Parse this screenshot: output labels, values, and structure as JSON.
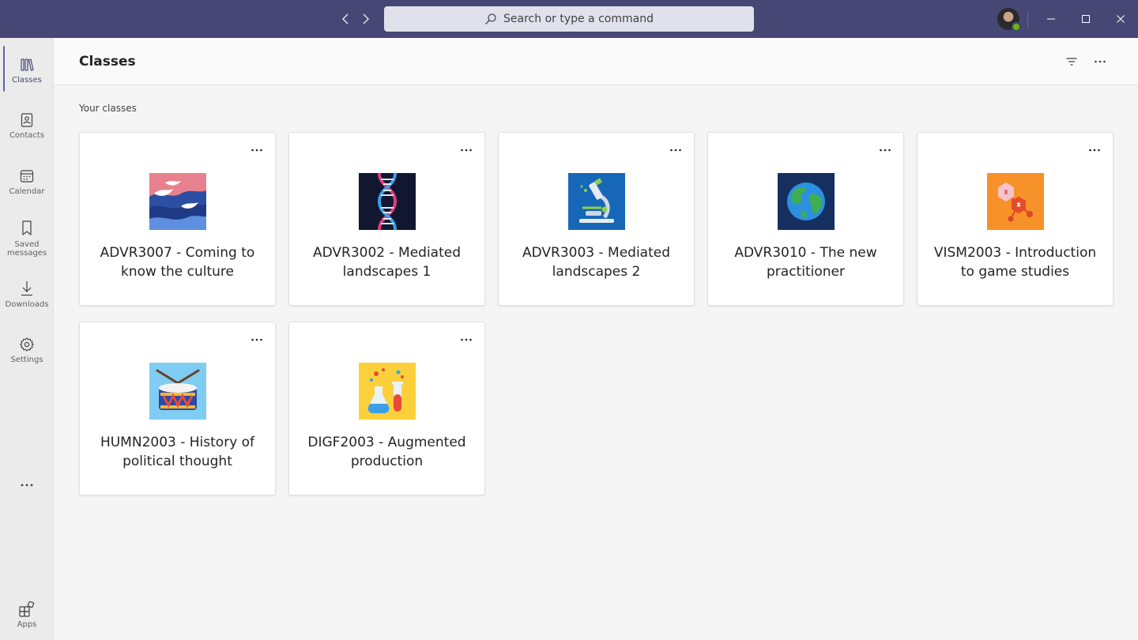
{
  "titlebar": {
    "search_placeholder": "Search or type a command"
  },
  "rail": {
    "items": [
      {
        "label": "Classes",
        "icon": "books-icon",
        "active": true
      },
      {
        "label": "Contacts",
        "icon": "contact-card-icon"
      },
      {
        "label": "Calendar",
        "icon": "calendar-icon"
      },
      {
        "label": "Saved messages",
        "icon": "bookmark-icon"
      },
      {
        "label": "Downloads",
        "icon": "download-icon"
      },
      {
        "label": "Settings",
        "icon": "gear-icon"
      },
      {
        "label": "Apps",
        "icon": "apps-icon"
      }
    ]
  },
  "header": {
    "title": "Classes"
  },
  "main": {
    "section_label": "Your classes",
    "classes": [
      {
        "title": "ADVR3007 - Coming to know the culture",
        "icon": "waves-icon"
      },
      {
        "title": "ADVR3002 - Mediated landscapes 1",
        "icon": "dna-icon"
      },
      {
        "title": "ADVR3003 - Mediated landscapes 2",
        "icon": "microscope-icon"
      },
      {
        "title": "ADVR3010 - The new practitioner",
        "icon": "globe-icon"
      },
      {
        "title": "VISM2003 -  Introduction to game studies",
        "icon": "molecules-icon"
      },
      {
        "title": "HUMN2003 - History of political thought",
        "icon": "drum-icon"
      },
      {
        "title": "DIGF2003 - Augmented production",
        "icon": "lab-flasks-icon"
      }
    ]
  },
  "colors": {
    "titlebar": "#464775",
    "accent": "#6264a7",
    "presence": "#6bb700"
  }
}
